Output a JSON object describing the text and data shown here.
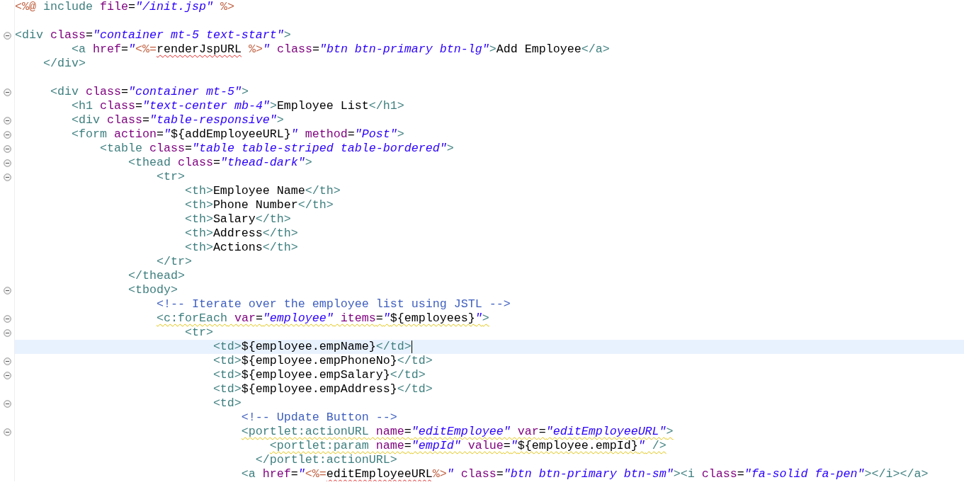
{
  "editor": {
    "lines": [
      {
        "fold": false,
        "tokens": [
          {
            "kind": "jsp",
            "text": "<%@"
          },
          {
            "kind": "tag",
            "text": " include"
          },
          {
            "kind": "attr",
            "text": " file"
          },
          {
            "kind": "plain",
            "text": "="
          },
          {
            "kind": "value",
            "text": "\"/init.jsp\""
          },
          {
            "kind": "jsp",
            "text": " %>"
          }
        ]
      },
      {
        "fold": false
      },
      {
        "fold": true,
        "tokens": [
          {
            "kind": "tag",
            "text": "<div"
          },
          {
            "kind": "attr",
            "text": " class"
          },
          {
            "kind": "plain",
            "text": "="
          },
          {
            "kind": "value",
            "text": "\"container mt-5 text-start\""
          },
          {
            "kind": "tag",
            "text": ">"
          }
        ]
      },
      {
        "fold": false,
        "tokens": [
          {
            "kind": "tag",
            "text": "        <a"
          },
          {
            "kind": "attr",
            "text": " href"
          },
          {
            "kind": "plain",
            "text": "="
          },
          {
            "kind": "value",
            "text": "\""
          },
          {
            "kind": "jsp",
            "text": "<%="
          },
          {
            "kind": "text",
            "text": "renderJspURL",
            "error": true
          },
          {
            "kind": "jsp",
            "text": " %>"
          },
          {
            "kind": "value",
            "text": "\""
          },
          {
            "kind": "attr",
            "text": " class"
          },
          {
            "kind": "plain",
            "text": "="
          },
          {
            "kind": "value",
            "text": "\"btn btn-primary btn-lg\""
          },
          {
            "kind": "tag",
            "text": ">"
          },
          {
            "kind": "text",
            "text": "Add Employee"
          },
          {
            "kind": "tag",
            "text": "</a>"
          }
        ]
      },
      {
        "fold": false,
        "tokens": [
          {
            "kind": "tag",
            "text": "    </div>"
          }
        ]
      },
      {
        "fold": false
      },
      {
        "fold": true,
        "tokens": [
          {
            "kind": "tag",
            "text": "     <div"
          },
          {
            "kind": "attr",
            "text": " class"
          },
          {
            "kind": "plain",
            "text": "="
          },
          {
            "kind": "value",
            "text": "\"container mt-5\""
          },
          {
            "kind": "tag",
            "text": ">"
          }
        ]
      },
      {
        "fold": false,
        "tokens": [
          {
            "kind": "tag",
            "text": "        <h1"
          },
          {
            "kind": "attr",
            "text": " class"
          },
          {
            "kind": "plain",
            "text": "="
          },
          {
            "kind": "value",
            "text": "\"text-center mb-4\""
          },
          {
            "kind": "tag",
            "text": ">"
          },
          {
            "kind": "text",
            "text": "Employee List"
          },
          {
            "kind": "tag",
            "text": "</h1>"
          }
        ]
      },
      {
        "fold": true,
        "tokens": [
          {
            "kind": "tag",
            "text": "        <div"
          },
          {
            "kind": "attr",
            "text": " class"
          },
          {
            "kind": "plain",
            "text": "="
          },
          {
            "kind": "value",
            "text": "\"table-responsive\""
          },
          {
            "kind": "tag",
            "text": ">"
          }
        ]
      },
      {
        "fold": true,
        "tokens": [
          {
            "kind": "tag",
            "text": "        <form"
          },
          {
            "kind": "attr",
            "text": " action"
          },
          {
            "kind": "plain",
            "text": "="
          },
          {
            "kind": "value",
            "text": "\""
          },
          {
            "kind": "text",
            "text": "${addEmployeeURL}"
          },
          {
            "kind": "value",
            "text": "\""
          },
          {
            "kind": "attr",
            "text": " method"
          },
          {
            "kind": "plain",
            "text": "="
          },
          {
            "kind": "value",
            "text": "\"Post\""
          },
          {
            "kind": "tag",
            "text": ">"
          }
        ]
      },
      {
        "fold": true,
        "tokens": [
          {
            "kind": "tag",
            "text": "            <table"
          },
          {
            "kind": "attr",
            "text": " class"
          },
          {
            "kind": "plain",
            "text": "="
          },
          {
            "kind": "value",
            "text": "\"table table-striped table-bordered\""
          },
          {
            "kind": "tag",
            "text": ">"
          }
        ]
      },
      {
        "fold": true,
        "tokens": [
          {
            "kind": "tag",
            "text": "                <thead"
          },
          {
            "kind": "attr",
            "text": " class"
          },
          {
            "kind": "plain",
            "text": "="
          },
          {
            "kind": "value",
            "text": "\"thead-dark\""
          },
          {
            "kind": "tag",
            "text": ">"
          }
        ]
      },
      {
        "fold": true,
        "tokens": [
          {
            "kind": "tag",
            "text": "                    <tr>"
          }
        ]
      },
      {
        "fold": false,
        "tokens": [
          {
            "kind": "tag",
            "text": "                        <th>"
          },
          {
            "kind": "text",
            "text": "Employee Name"
          },
          {
            "kind": "tag",
            "text": "</th>"
          }
        ]
      },
      {
        "fold": false,
        "tokens": [
          {
            "kind": "tag",
            "text": "                        <th>"
          },
          {
            "kind": "text",
            "text": "Phone Number"
          },
          {
            "kind": "tag",
            "text": "</th>"
          }
        ]
      },
      {
        "fold": false,
        "tokens": [
          {
            "kind": "tag",
            "text": "                        <th>"
          },
          {
            "kind": "text",
            "text": "Salary"
          },
          {
            "kind": "tag",
            "text": "</th>"
          }
        ]
      },
      {
        "fold": false,
        "tokens": [
          {
            "kind": "tag",
            "text": "                        <th>"
          },
          {
            "kind": "text",
            "text": "Address"
          },
          {
            "kind": "tag",
            "text": "</th>"
          }
        ]
      },
      {
        "fold": false,
        "tokens": [
          {
            "kind": "tag",
            "text": "                        <th>"
          },
          {
            "kind": "text",
            "text": "Actions"
          },
          {
            "kind": "tag",
            "text": "</th>"
          }
        ]
      },
      {
        "fold": false,
        "tokens": [
          {
            "kind": "tag",
            "text": "                    </tr>"
          }
        ]
      },
      {
        "fold": false,
        "tokens": [
          {
            "kind": "tag",
            "text": "                </thead>"
          }
        ]
      },
      {
        "fold": true,
        "tokens": [
          {
            "kind": "tag",
            "text": "                <tbody>"
          }
        ]
      },
      {
        "fold": false,
        "tokens": [
          {
            "kind": "comment",
            "text": "                    <!-- Iterate over the employee list using JSTL -->"
          }
        ]
      },
      {
        "fold": true,
        "warning": true,
        "tokens": [
          {
            "kind": "tag",
            "text": "                    <c:forEach"
          },
          {
            "kind": "attr",
            "text": " var"
          },
          {
            "kind": "plain",
            "text": "="
          },
          {
            "kind": "value",
            "text": "\"employee\""
          },
          {
            "kind": "attr",
            "text": " items"
          },
          {
            "kind": "plain",
            "text": "="
          },
          {
            "kind": "value",
            "text": "\""
          },
          {
            "kind": "text",
            "text": "${employees}"
          },
          {
            "kind": "value",
            "text": "\""
          },
          {
            "kind": "tag",
            "text": ">"
          }
        ]
      },
      {
        "fold": true,
        "tokens": [
          {
            "kind": "tag",
            "text": "                        <tr>"
          }
        ]
      },
      {
        "fold": false,
        "current": true,
        "tokens": [
          {
            "kind": "tag",
            "text": "                            <td>"
          },
          {
            "kind": "text",
            "text": "${employee.empName}"
          },
          {
            "kind": "tag",
            "text": "</td>"
          }
        ]
      },
      {
        "fold": true,
        "tokens": [
          {
            "kind": "tag",
            "text": "                            <td>"
          },
          {
            "kind": "text",
            "text": "${employee.empPhoneNo}"
          },
          {
            "kind": "tag",
            "text": "</td>"
          }
        ]
      },
      {
        "fold": true,
        "tokens": [
          {
            "kind": "tag",
            "text": "                            <td>"
          },
          {
            "kind": "text",
            "text": "${employee.empSalary}"
          },
          {
            "kind": "tag",
            "text": "</td>"
          }
        ]
      },
      {
        "fold": false,
        "tokens": [
          {
            "kind": "tag",
            "text": "                            <td>"
          },
          {
            "kind": "text",
            "text": "${employee.empAddress}"
          },
          {
            "kind": "tag",
            "text": "</td>"
          }
        ]
      },
      {
        "fold": true,
        "tokens": [
          {
            "kind": "tag",
            "text": "                            <td>"
          }
        ]
      },
      {
        "fold": false,
        "tokens": [
          {
            "kind": "comment",
            "text": "                                <!-- Update Button -->"
          }
        ]
      },
      {
        "fold": true,
        "warning": true,
        "tokens": [
          {
            "kind": "tag",
            "text": "                                <portlet:actionURL"
          },
          {
            "kind": "attr",
            "text": " name"
          },
          {
            "kind": "plain",
            "text": "="
          },
          {
            "kind": "value",
            "text": "\"editEmployee\""
          },
          {
            "kind": "attr",
            "text": " var"
          },
          {
            "kind": "plain",
            "text": "="
          },
          {
            "kind": "value",
            "text": "\"editEmployeeURL\""
          },
          {
            "kind": "tag",
            "text": ">"
          }
        ]
      },
      {
        "fold": false,
        "warning": true,
        "tokens": [
          {
            "kind": "tag",
            "text": "                                    <portlet:param"
          },
          {
            "kind": "attr",
            "text": " name"
          },
          {
            "kind": "plain",
            "text": "="
          },
          {
            "kind": "value",
            "text": "\"empId\""
          },
          {
            "kind": "attr",
            "text": " value"
          },
          {
            "kind": "plain",
            "text": "="
          },
          {
            "kind": "value",
            "text": "\""
          },
          {
            "kind": "text",
            "text": "${employee.empId}"
          },
          {
            "kind": "value",
            "text": "\""
          },
          {
            "kind": "tag",
            "text": " />"
          }
        ]
      },
      {
        "fold": false,
        "tokens": [
          {
            "kind": "tag",
            "text": "                                  </portlet:actionURL>"
          }
        ]
      },
      {
        "fold": false,
        "tokens": [
          {
            "kind": "tag",
            "text": "                                <a"
          },
          {
            "kind": "attr",
            "text": " href"
          },
          {
            "kind": "plain",
            "text": "="
          },
          {
            "kind": "value",
            "text": "\""
          },
          {
            "kind": "jsp",
            "text": "<%="
          },
          {
            "kind": "text",
            "text": "editEmployeeURL",
            "error": true
          },
          {
            "kind": "jsp",
            "text": "%>"
          },
          {
            "kind": "value",
            "text": "\""
          },
          {
            "kind": "attr",
            "text": " class"
          },
          {
            "kind": "plain",
            "text": "="
          },
          {
            "kind": "value",
            "text": "\"btn btn-primary btn-sm\""
          },
          {
            "kind": "tag",
            "text": "><i"
          },
          {
            "kind": "attr",
            "text": " class"
          },
          {
            "kind": "plain",
            "text": "="
          },
          {
            "kind": "value",
            "text": "\"fa-solid fa-pen\""
          },
          {
            "kind": "tag",
            "text": "></i></a>"
          }
        ]
      }
    ]
  }
}
